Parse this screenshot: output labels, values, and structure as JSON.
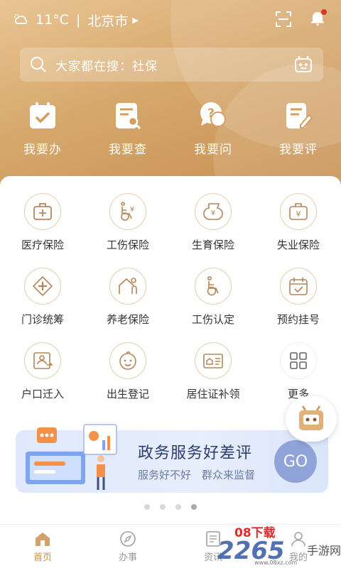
{
  "status": {
    "weather": "11°C",
    "city": "北京市"
  },
  "search": {
    "text": "大家都在搜：社保"
  },
  "quick_actions": [
    {
      "label": "我要办",
      "icon": "calendar-check-icon"
    },
    {
      "label": "我要查",
      "icon": "document-search-icon"
    },
    {
      "label": "我要问",
      "icon": "question-bubble-icon"
    },
    {
      "label": "我要评",
      "icon": "document-edit-icon"
    }
  ],
  "services": [
    {
      "label": "医疗保险",
      "icon": "medical-kit-icon"
    },
    {
      "label": "工伤保险",
      "icon": "wheelchair-yuan-icon"
    },
    {
      "label": "生育保险",
      "icon": "maternity-yuan-icon"
    },
    {
      "label": "失业保险",
      "icon": "briefcase-yuan-icon"
    },
    {
      "label": "门诊统筹",
      "icon": "clinic-cross-icon"
    },
    {
      "label": "养老保险",
      "icon": "elderly-home-icon"
    },
    {
      "label": "工伤认定",
      "icon": "wheelchair-icon"
    },
    {
      "label": "预约挂号",
      "icon": "calendar-check-icon"
    },
    {
      "label": "户口迁入",
      "icon": "id-card-transfer-icon"
    },
    {
      "label": "出生登记",
      "icon": "baby-face-icon"
    },
    {
      "label": "居住证补领",
      "icon": "residence-card-icon"
    },
    {
      "label": "更多",
      "icon": "grid-more-icon"
    }
  ],
  "banner": {
    "title": "政务服务好差评",
    "subtitle": "服务好不好　群众来监督",
    "button": "GO"
  },
  "carousel": {
    "total": 4,
    "active": 4
  },
  "tabs": [
    {
      "label": "首页",
      "icon": "home-icon",
      "active": true
    },
    {
      "label": "办事",
      "icon": "compass-icon",
      "active": false
    },
    {
      "label": "资讯",
      "icon": "news-icon",
      "active": false
    },
    {
      "label": "我的",
      "icon": "user-icon",
      "active": false
    }
  ],
  "watermark": {
    "brand": "08下载",
    "logo": "2265",
    "suffix": "手游网",
    "url": "www.08xz.com"
  },
  "colors": {
    "accent": "#c89256",
    "hero": "#d6a76b",
    "banner": "#dfe9fb",
    "go": "#8fa3d9"
  }
}
